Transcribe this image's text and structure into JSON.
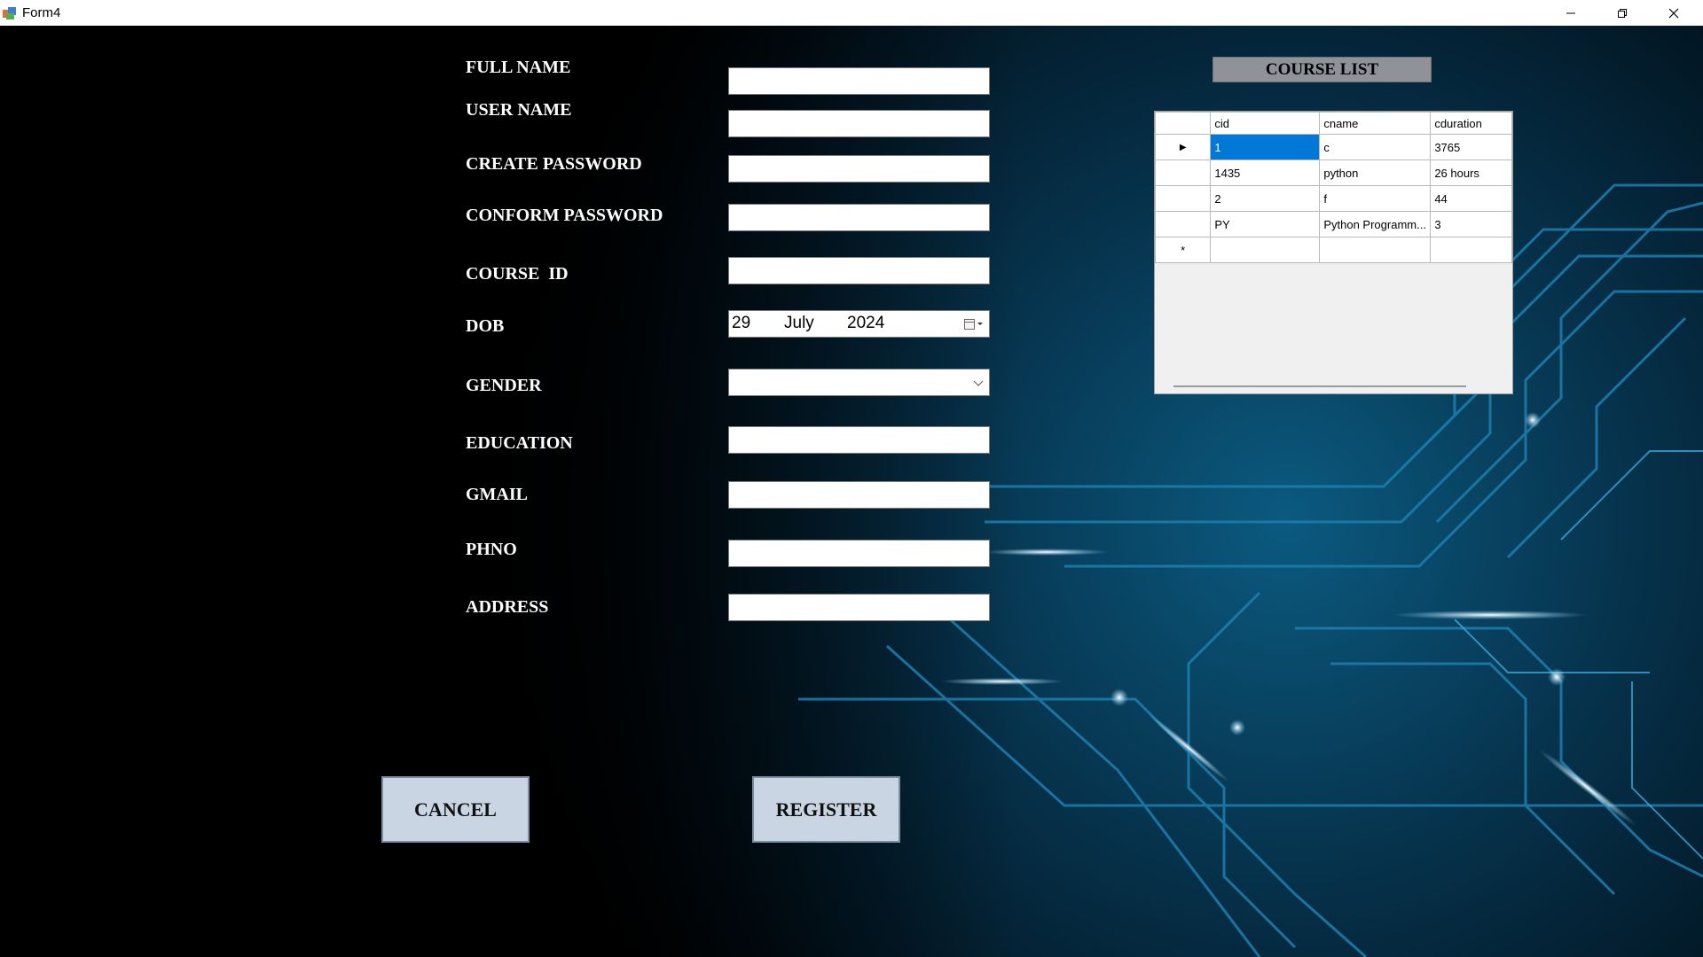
{
  "window": {
    "title": "Form4"
  },
  "form": {
    "labels": {
      "full_name": "FULL NAME",
      "user_name": "USER NAME",
      "create_password": "CREATE PASSWORD",
      "confirm_password": "CONFORM PASSWORD",
      "course_id": "COURSE  ID",
      "dob": "DOB",
      "gender": "GENDER",
      "education": "EDUCATION",
      "gmail": "GMAIL",
      "phno": "PHNO",
      "address": "ADDRESS"
    },
    "values": {
      "full_name": "",
      "user_name": "",
      "create_password": "",
      "confirm_password": "",
      "course_id": "",
      "gender": "",
      "education": "",
      "gmail": "",
      "phno": "",
      "address": ""
    },
    "dob": {
      "day": "29",
      "month": "July",
      "year": "2024"
    }
  },
  "buttons": {
    "cancel": "CANCEL",
    "register": "REGISTER"
  },
  "course_list": {
    "title": "COURSE LIST",
    "columns": [
      "cid",
      "cname",
      "cduration"
    ],
    "rows": [
      [
        "1",
        "c",
        "3765"
      ],
      [
        "1435",
        "python",
        "26 hours"
      ],
      [
        "2",
        "f",
        "44"
      ],
      [
        "PY",
        "Python Programm...",
        "3"
      ]
    ],
    "selected_row": 0,
    "new_row_marker": "*",
    "current_row_marker": "▶"
  },
  "colors": {
    "selection": "#0078d7",
    "button_face": "#c9d5e3",
    "header_face": "#8f9296"
  },
  "icons": {
    "title_bar": "app-icon",
    "window_controls": [
      "minimize-icon",
      "restore-icon",
      "close-icon"
    ],
    "date_picker": "calendar-icon",
    "gender_select": "chevron-down-icon"
  }
}
